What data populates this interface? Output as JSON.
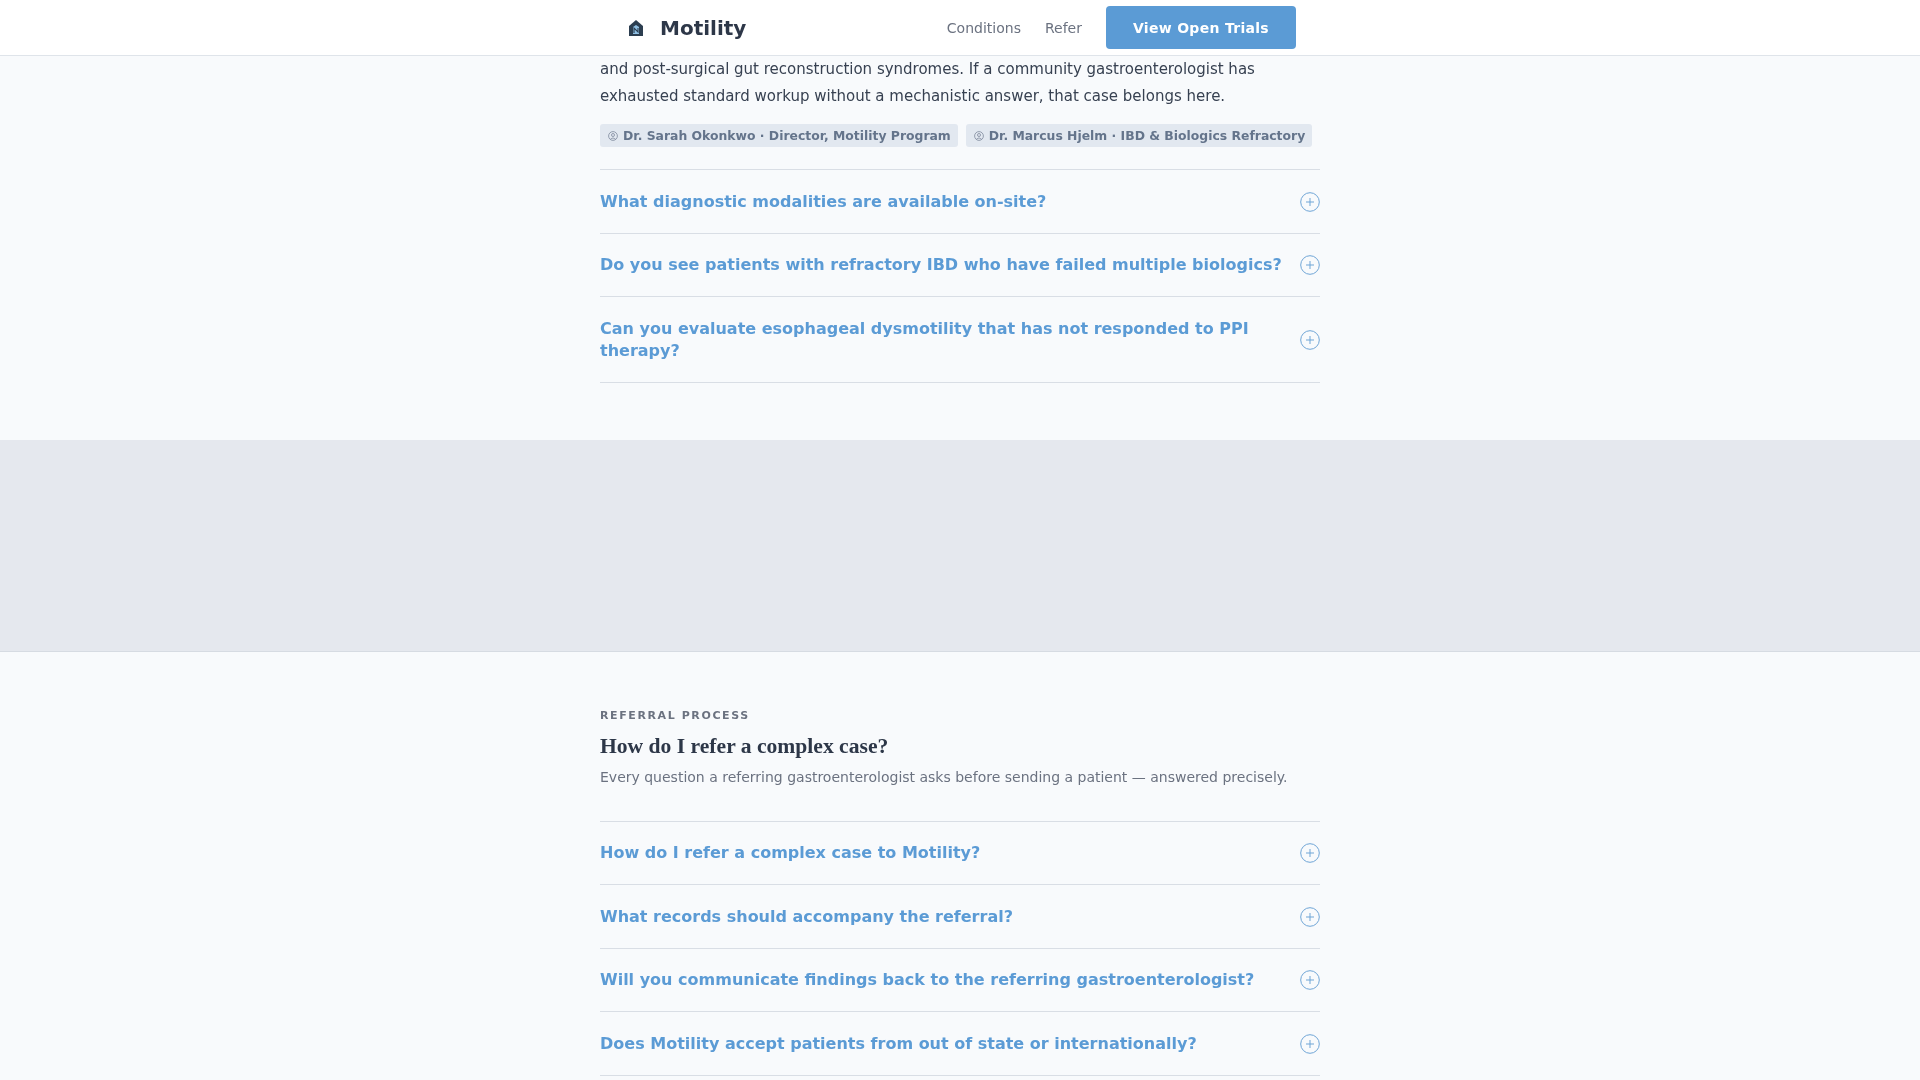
{
  "header": {
    "brand": "Motility",
    "nav": [
      {
        "label": "Conditions"
      },
      {
        "label": "Refer"
      }
    ],
    "cta": "View Open Trials"
  },
  "intro": {
    "text": "and post-surgical gut reconstruction syndromes. If a community gastroenterologist has exhausted standard workup without a mechanistic answer, that case belongs here.",
    "people": [
      "Dr. Sarah Okonkwo · Director, Motility Program",
      "Dr. Marcus Hjelm · IBD & Biologics Refractory"
    ]
  },
  "faq": [
    {
      "question": "What diagnostic modalities are available on-site?",
      "expanded": false
    },
    {
      "question": "Do you see patients with refractory IBD who have failed multiple biologics?",
      "expanded": false
    },
    {
      "question": "Can you evaluate esophageal dysmotility that has not responded to PPI therapy?",
      "expanded": false
    }
  ],
  "referral": {
    "eyebrow": "REFERRAL PROCESS",
    "title": "How do I refer a complex case?",
    "subtitle": "Every question a referring gastroenterologist asks before sending a patient — answered precisely.",
    "faq": [
      {
        "question": "How do I refer a complex case to Motility?",
        "expanded": false
      },
      {
        "question": "What records should accompany the referral?",
        "expanded": false
      },
      {
        "question": "Will you communicate findings back to the referring gastroenterologist?",
        "expanded": false
      },
      {
        "question": "Does Motility accept patients from out of state or internationally?",
        "expanded": false
      }
    ]
  }
}
